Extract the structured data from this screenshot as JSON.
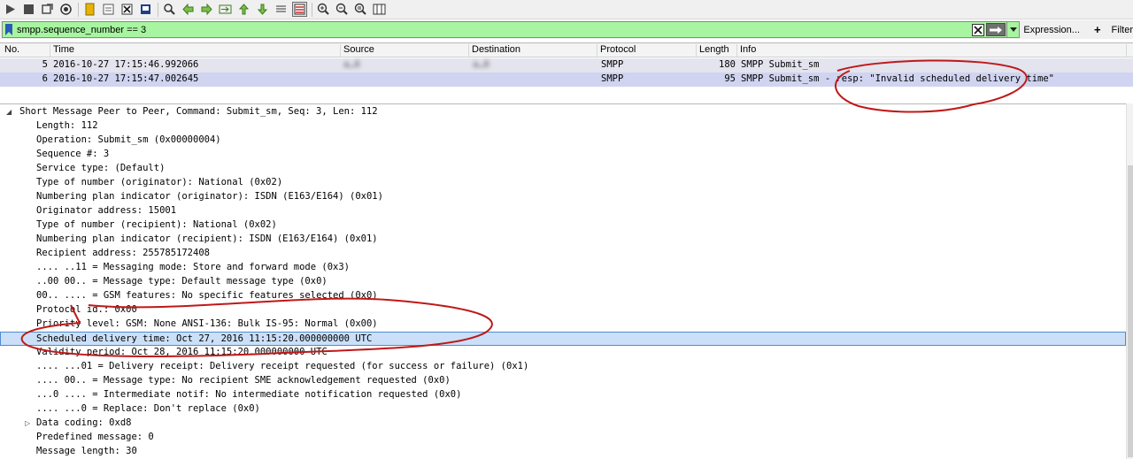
{
  "toolbar": {
    "buttons": [
      "start-capture-icon",
      "stop-capture-icon",
      "restart-capture-icon",
      "capture-options-icon",
      "open-file-icon",
      "save-file-icon",
      "close-file-icon",
      "reload-file-icon",
      "find-packet-icon",
      "go-back-icon",
      "go-forward-icon",
      "go-to-packet-icon",
      "go-first-icon",
      "go-last-icon",
      "autoscroll-icon",
      "colorize-icon",
      "zoom-in-icon",
      "zoom-out-icon",
      "normal-size-icon",
      "resize-columns-icon"
    ]
  },
  "filter": {
    "value": "smpp.sequence_number == 3",
    "expression_label": "Expression...",
    "plus_label": "+",
    "filter_label": "Filter"
  },
  "packet_list": {
    "columns": [
      "No.",
      "Time",
      "Source",
      "Destination",
      "Protocol",
      "Length",
      "Info"
    ],
    "rows": [
      {
        "no": "5",
        "time": "2016-10-27 17:15:46.992066",
        "source": "a…6",
        "destination": "a…6",
        "protocol": "SMPP",
        "length": "180",
        "info": "SMPP Submit_sm"
      },
      {
        "no": "6",
        "time": "2016-10-27 17:15:47.002645",
        "source": "",
        "destination": "",
        "protocol": "SMPP",
        "length": "95",
        "info": "SMPP Submit_sm - resp: \"Invalid scheduled delivery time\""
      }
    ]
  },
  "detail": {
    "header": "Short Message Peer to Peer, Command: Submit_sm, Seq: 3, Len: 112",
    "lines": [
      "Length: 112",
      "Operation: Submit_sm (0x00000004)",
      "Sequence #: 3",
      "Service type: (Default)",
      "Type of number (originator): National (0x02)",
      "Numbering plan indicator (originator): ISDN (E163/E164) (0x01)",
      "Originator address: 15001",
      "Type of number (recipient): National (0x02)",
      "Numbering plan indicator (recipient): ISDN (E163/E164) (0x01)",
      "Recipient address: 255785172408",
      ".... ..11 = Messaging mode: Store and forward mode (0x3)",
      "..00 00.. = Message type: Default message type (0x0)",
      "00.. .... = GSM features: No specific features selected (0x0)",
      "Protocol id.: 0x00",
      "Priority level: GSM: None    ANSI-136: Bulk        IS-95: Normal (0x00)",
      "Scheduled delivery time: Oct 27, 2016 11:15:20.000000000 UTC",
      "Validity period: Oct 28, 2016 11:15:20.000000000 UTC",
      ".... ...01 = Delivery receipt: Delivery receipt requested (for success or failure) (0x1)",
      ".... 00.. = Message type: No recipient SME acknowledgement requested (0x0)",
      "...0 .... = Intermediate notif: No intermediate notification requested (0x0)",
      ".... ...0 = Replace: Don't replace (0x0)",
      "Data coding: 0xd8",
      "Predefined message: 0",
      "Message length: 30"
    ]
  },
  "colors": {
    "filter_bg": "#a7f5a0",
    "row_selected": "#d0d4f0",
    "tree_selected": "#cbe0f8",
    "annotation": "#c01818"
  }
}
